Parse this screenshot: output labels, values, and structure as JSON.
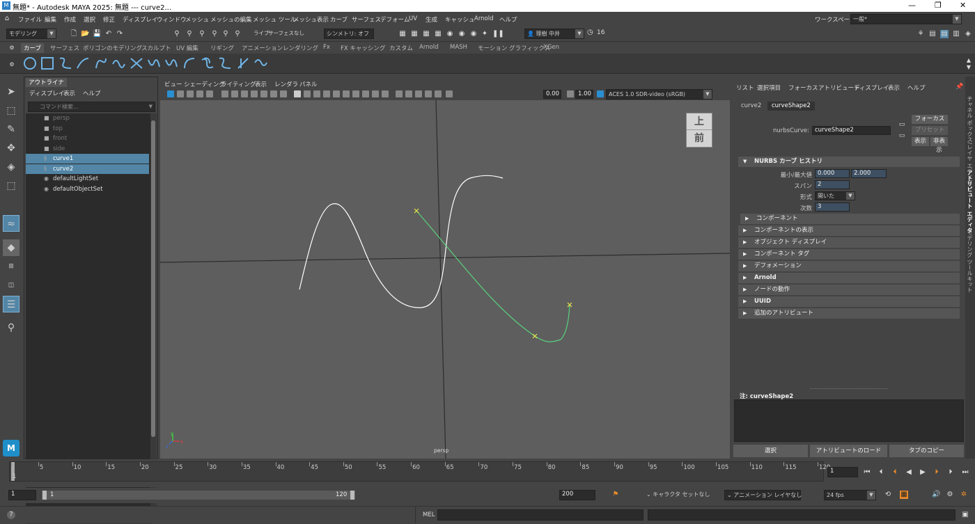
{
  "app": {
    "title": "無題* - Autodesk MAYA 2025: 無題   ---   curve2...",
    "logo": "M"
  },
  "window_controls": {
    "minimize": "—",
    "maximize": "❐",
    "close": "✕"
  },
  "menubar": {
    "items": [
      "ファイル",
      "編集",
      "作成",
      "選択",
      "修正",
      "ディスプレイ",
      "ウィンドウ",
      "メッシュ",
      "メッシュの編集",
      "メッシュ ツール",
      "メッシュ表示",
      "カーブ",
      "サーフェス",
      "デフォーム",
      "UV",
      "生成",
      "キャッシュ",
      "Arnold",
      "ヘルプ"
    ],
    "workspace_label": "ワークスペース:",
    "workspace_value": "一般*"
  },
  "statusline": {
    "mode": "モデリング",
    "live": "ライブ",
    "live_surface": "サーフェスなし",
    "symmetry": "シンメトリ: オフ",
    "user": "理樹 中井",
    "count": "16"
  },
  "shelf": {
    "tabs": [
      "カーブ",
      "サーフェス",
      "ポリゴンのモデリング",
      "スカルプト",
      "UV 編集",
      "リギング",
      "アニメーション",
      "レンダリング",
      "Fx",
      "FX キャッシング",
      "カスタム",
      "Arnold",
      "MASH",
      "モーション グラフィックス",
      "XGen"
    ],
    "active_tab": 0
  },
  "outliner": {
    "tab": "アウトライナ",
    "menu": [
      "ディスプレイ",
      "表示",
      "ヘルプ"
    ],
    "search_placeholder": "コマンド検索...",
    "rows": [
      {
        "label": "persp",
        "type": "camera",
        "state": "dim"
      },
      {
        "label": "top",
        "type": "camera",
        "state": "dim"
      },
      {
        "label": "front",
        "type": "camera",
        "state": "dim"
      },
      {
        "label": "side",
        "type": "camera",
        "state": "dim"
      },
      {
        "label": "curve1",
        "type": "curve",
        "state": "sel"
      },
      {
        "label": "curve2",
        "type": "curve",
        "state": "sel"
      },
      {
        "label": "defaultLightSet",
        "type": "set",
        "state": ""
      },
      {
        "label": "defaultObjectSet",
        "type": "set",
        "state": ""
      }
    ]
  },
  "viewport": {
    "menu": [
      "ビュー",
      "シェーディング",
      "ライティング",
      "表示",
      "レンダラ",
      "パネル"
    ],
    "near": "0.00",
    "far": "1.00",
    "color_space": "ACES 1.0 SDR-video (sRGB)",
    "camera_label": "persp",
    "viewcube_top": "上",
    "viewcube_front": "前",
    "axis_x": "x",
    "axis_y": "y",
    "axis_z": "z"
  },
  "attribute_editor": {
    "menu": [
      "リスト",
      "選択項目",
      "フォーカス",
      "アトリビュート",
      "ディスプレイ",
      "表示",
      "ヘルプ"
    ],
    "tabs": [
      "curve2",
      "curveShape2"
    ],
    "node_type_label": "nurbsCurve:",
    "node_name": "curveShape2",
    "focus_button": "フォーカス",
    "preset_button": "プリセット",
    "show_button": "表示",
    "hide_button": "非表示",
    "section_history": "NURBS カーブ ヒストリ",
    "minmax_label": "最小/最大値",
    "min_value": "0.000",
    "max_value": "2.000",
    "spans_label": "スパン",
    "spans_value": "2",
    "form_label": "形式",
    "form_value": "開いた",
    "degree_label": "次数",
    "degree_value": "3",
    "sections": [
      "コンポーネント",
      "コンポーネントの表示",
      "オブジェクト ディスプレイ",
      "コンポーネント タグ",
      "デフォメーション",
      "Arnold",
      "ノードの動作",
      "UUID",
      "追加のアトリビュート"
    ],
    "notes_label": "注:  curveShape2",
    "bottom_buttons": [
      "選択",
      "アトリビュートのロード",
      "タブのコピー"
    ]
  },
  "side_tabs": [
    "チャネル ボックス/レイヤ エディタ",
    "アトリビュート エディタ",
    "モデリング ツールキット"
  ],
  "timeslider": {
    "ticks": [
      1,
      5,
      10,
      15,
      20,
      25,
      30,
      35,
      40,
      45,
      50,
      55,
      60,
      65,
      70,
      75,
      80,
      85,
      90,
      95,
      100,
      105,
      110,
      115,
      120
    ],
    "current_frame": "1",
    "range_start": "1",
    "range_inner_start": "1",
    "range_inner_end": "120",
    "range_end": "200",
    "character_set": "キャラクタ セットなし",
    "anim_layer": "アニメーション レイヤなし",
    "fps": "24 fps"
  },
  "commandline": {
    "language": "MEL",
    "help_icon": "?"
  },
  "colors": {
    "accent": "#5285a6",
    "curve1": "#ffffff",
    "curve2": "#5ad17e",
    "cv_marker": "#e7e74a"
  }
}
